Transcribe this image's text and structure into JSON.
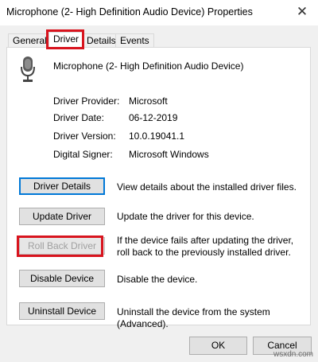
{
  "window": {
    "title": "Microphone (2- High Definition Audio Device) Properties"
  },
  "tabs": [
    {
      "label": "General"
    },
    {
      "label": "Driver"
    },
    {
      "label": "Details"
    },
    {
      "label": "Events"
    }
  ],
  "device": {
    "name": "Microphone (2- High Definition Audio Device)",
    "icon": "microphone-icon"
  },
  "properties": [
    {
      "label": "Driver Provider:",
      "value": "Microsoft"
    },
    {
      "label": "Driver Date:",
      "value": "06-12-2019"
    },
    {
      "label": "Driver Version:",
      "value": "10.0.19041.1"
    },
    {
      "label": "Digital Signer:",
      "value": "Microsoft Windows"
    }
  ],
  "actions": [
    {
      "label": "Driver Details",
      "description": "View details about the installed driver files."
    },
    {
      "label": "Update Driver",
      "description": "Update the driver for this device."
    },
    {
      "label": "Roll Back Driver",
      "description": "If the device fails after updating the driver, roll back to the previously installed driver."
    },
    {
      "label": "Disable Device",
      "description": "Disable the device."
    },
    {
      "label": "Uninstall Device",
      "description": "Uninstall the device from the system (Advanced)."
    }
  ],
  "footer": {
    "ok_label": "OK",
    "cancel_label": "Cancel"
  },
  "watermark": "wsxdn.com",
  "colors": {
    "highlight": "#d8141e",
    "focus": "#0078d7"
  }
}
